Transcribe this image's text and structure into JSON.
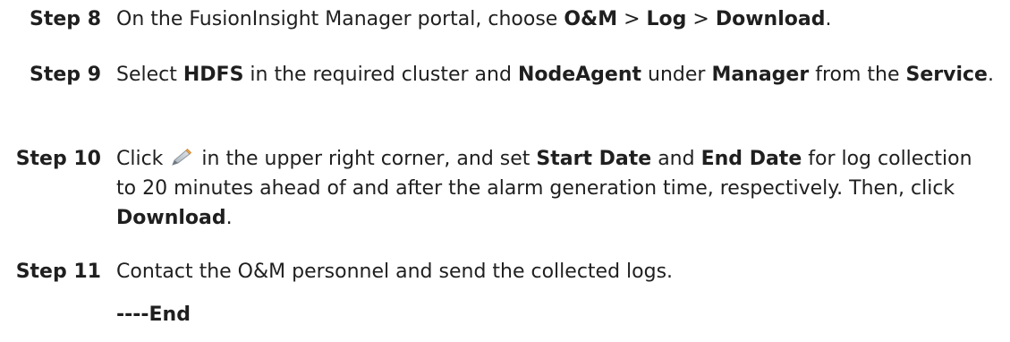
{
  "steps": [
    {
      "label": "Step 8",
      "t1": "On the FusionInsight Manager portal, choose ",
      "b1": "O&M",
      "t2": " > ",
      "b2": "Log",
      "t3": " > ",
      "b3": "Download",
      "t4": "."
    },
    {
      "label": "Step 9",
      "t1": "Select ",
      "b1": "HDFS",
      "t2": " in the required cluster and ",
      "b2": "NodeAgent",
      "t3": " under ",
      "b3": "Manager",
      "t4": " from the ",
      "b4": "Service",
      "t5": "."
    },
    {
      "label": "Step 10",
      "t1": "Click ",
      "icon": "pencil-icon",
      "t2": " in the upper right corner, and set ",
      "b1": "Start Date",
      "t3": " and ",
      "b2": "End Date",
      "t4": " for log collection to 20 minutes ahead of and after the alarm generation time, respectively. Then, click ",
      "b3": "Download",
      "t5": "."
    },
    {
      "label": "Step 11",
      "t1": "Contact the O&M personnel and send the collected logs."
    }
  ],
  "end_marker": "----End"
}
